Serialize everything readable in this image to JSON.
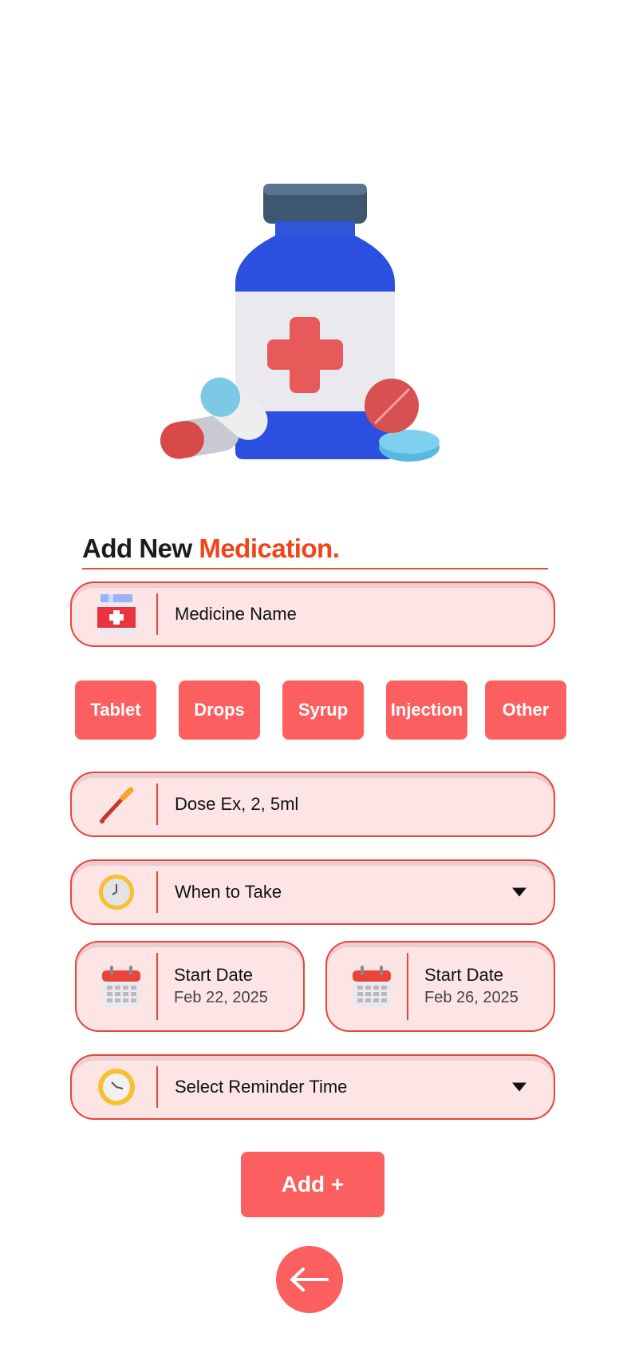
{
  "header": {
    "title_main": "Add New",
    "title_accent": "Medication",
    "title_dot": "."
  },
  "medicine_name": {
    "placeholder": "Medicine Name",
    "icon": "medicine-box-icon"
  },
  "types": [
    "Tablet",
    "Drops",
    "Syrup",
    "Injection",
    "Other"
  ],
  "dose": {
    "placeholder": "Dose Ex, 2, 5ml",
    "icon": "dropper-icon"
  },
  "when": {
    "label": "When to Take",
    "icon": "clock-icon"
  },
  "start_date": {
    "label": "Start Date",
    "value": "Feb 22, 2025",
    "icon": "calendar-icon"
  },
  "end_date": {
    "label": "Start Date",
    "value": "Feb 26, 2025",
    "icon": "calendar-icon"
  },
  "reminder": {
    "label": "Select Reminder Time",
    "icon": "alarm-clock-icon"
  },
  "actions": {
    "add_label": "Add +",
    "back_icon": "arrow-left-icon"
  },
  "colors": {
    "accent": "#f0441a",
    "button": "#fb5f5f",
    "field_bg": "#fde5e6",
    "field_border": "#e8443a"
  }
}
